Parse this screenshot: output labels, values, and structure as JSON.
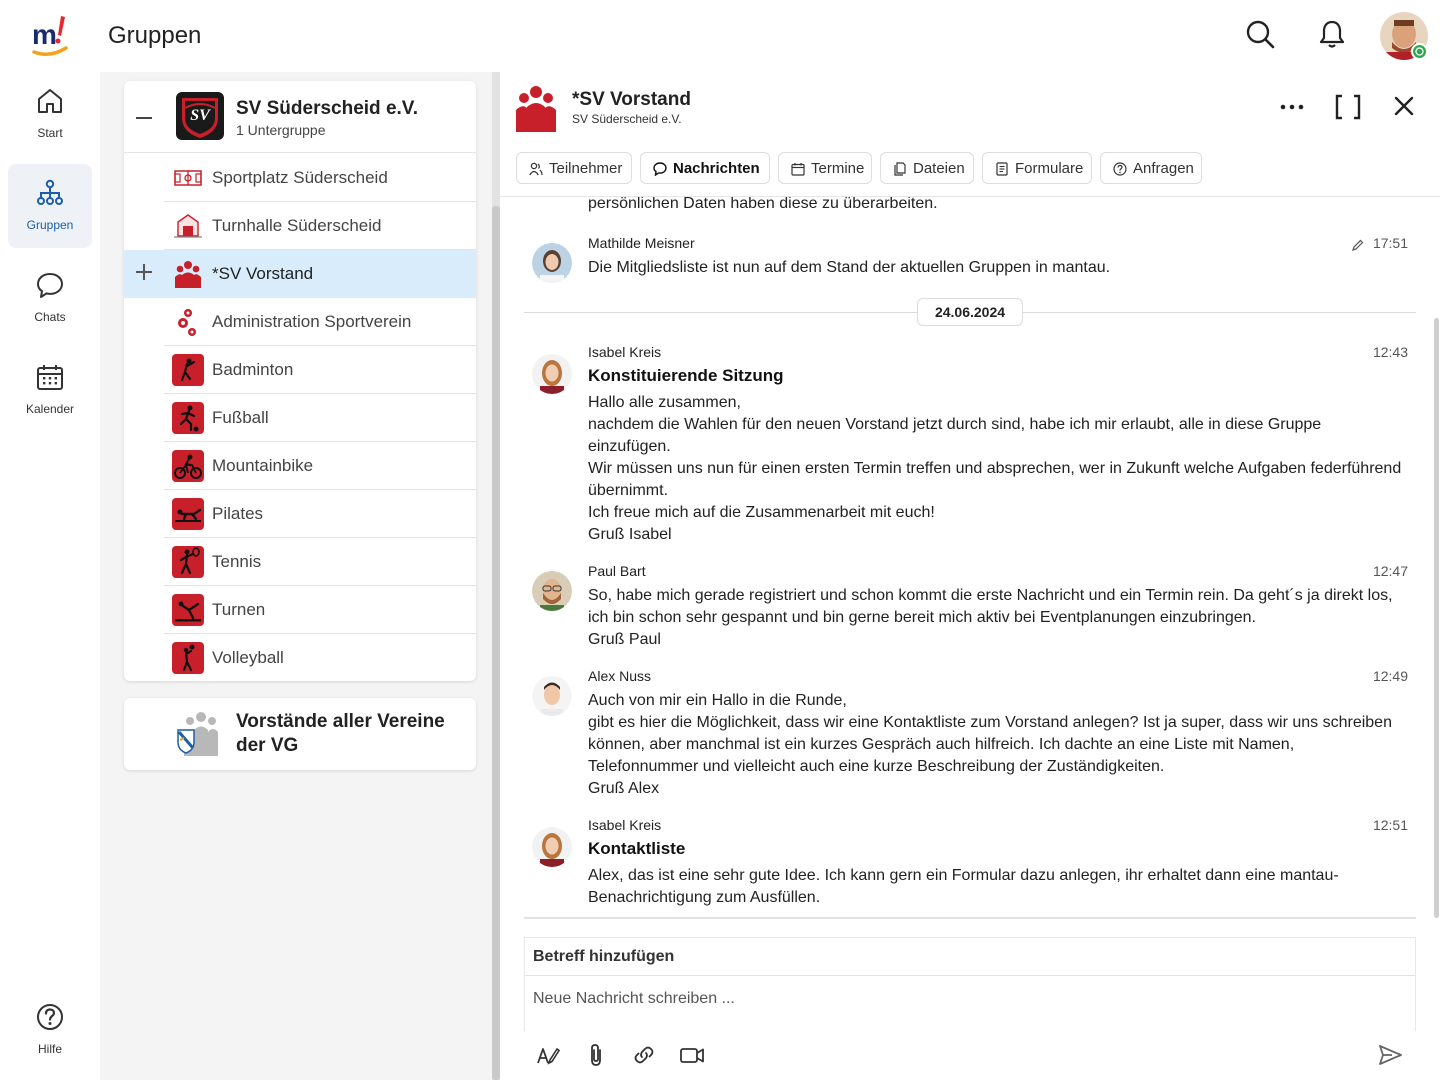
{
  "app": {
    "page_title": "Gruppen"
  },
  "nav": {
    "start": "Start",
    "gruppen": "Gruppen",
    "chats": "Chats",
    "kalender": "Kalender",
    "hilfe": "Hilfe"
  },
  "group": {
    "title": "SV Süderscheid e.V.",
    "subtitle": "1 Untergruppe",
    "items": [
      {
        "label": "Sportplatz Süderscheid",
        "icon": "field-icon"
      },
      {
        "label": "Turnhalle Süderscheid",
        "icon": "gym-icon"
      },
      {
        "label": "*SV Vorstand",
        "icon": "people-icon",
        "active": true
      },
      {
        "label": "Administration Sportverein",
        "icon": "gears-icon"
      },
      {
        "label": "Badminton",
        "icon": "badminton-icon"
      },
      {
        "label": "Fußball",
        "icon": "football-icon"
      },
      {
        "label": "Mountainbike",
        "icon": "bike-icon"
      },
      {
        "label": "Pilates",
        "icon": "pilates-icon"
      },
      {
        "label": "Tennis",
        "icon": "tennis-icon"
      },
      {
        "label": "Turnen",
        "icon": "gymnastics-icon"
      },
      {
        "label": "Volleyball",
        "icon": "volleyball-icon"
      }
    ]
  },
  "group2": {
    "title": "Vorstände aller Vereine der VG"
  },
  "chat": {
    "title": "*SV Vorstand",
    "subtitle": "SV Süderscheid e.V.",
    "tabs": [
      "Teilnehmer",
      "Nachrichten",
      "Termine",
      "Dateien",
      "Formulare",
      "Anfragen"
    ],
    "active_tab": "Nachrichten",
    "cut_line": "persönlichen Daten haben diese zu überarbeiten.",
    "date_separator": "24.06.2024",
    "messages": [
      {
        "author": "Mathilde Meisner",
        "time": "17:51",
        "edited": true,
        "subject": "",
        "body": "Die Mitgliedsliste ist nun auf dem Stand der aktuellen Gruppen in mantau."
      },
      {
        "author": "Isabel Kreis",
        "time": "12:43",
        "subject": "Konstituierende Sitzung",
        "body": "Hallo alle zusammen,\nnachdem die Wahlen für den neuen Vorstand jetzt durch sind, habe ich mir erlaubt, alle in diese Gruppe einzufügen.\nWir müssen uns nun für einen ersten Termin treffen und absprechen, wer in Zukunft welche Aufgaben federführend übernimmt.\nIch freue mich auf die Zusammenarbeit mit euch!\nGruß Isabel"
      },
      {
        "author": "Paul Bart",
        "time": "12:47",
        "subject": "",
        "body": "So, habe mich gerade registriert und schon kommt die erste Nachricht und ein Termin rein. Da geht´s ja direkt los, ich bin schon sehr gespannt und bin gerne bereit mich aktiv bei Eventplanungen einzubringen.\nGruß Paul"
      },
      {
        "author": "Alex Nuss",
        "time": "12:49",
        "subject": "",
        "body": "Auch von mir ein Hallo in die Runde,\ngibt es hier die Möglichkeit, dass wir eine Kontaktliste zum Vorstand anlegen? Ist ja super, dass wir uns schreiben können, aber manchmal ist ein kurzes Gespräch auch hilfreich. Ich dachte an eine Liste mit Namen, Telefonnummer und vielleicht auch eine kurze Beschreibung der Zuständigkeiten.\nGruß Alex"
      },
      {
        "author": "Isabel Kreis",
        "time": "12:51",
        "subject": "Kontaktliste",
        "body": "Alex, das ist eine sehr gute Idee. Ich kann gern ein Formular dazu anlegen, ihr erhaltet dann eine mantau-Benachrichtigung zum Ausfüllen."
      }
    ],
    "composer": {
      "subject_placeholder": "Betreff hinzufügen",
      "message_placeholder": "Neue Nachricht schreiben ..."
    }
  },
  "colors": {
    "accent": "#1b5fa8",
    "active_row": "#d8ecfb",
    "brand_red": "#c8202a",
    "online": "#2fa84f"
  }
}
